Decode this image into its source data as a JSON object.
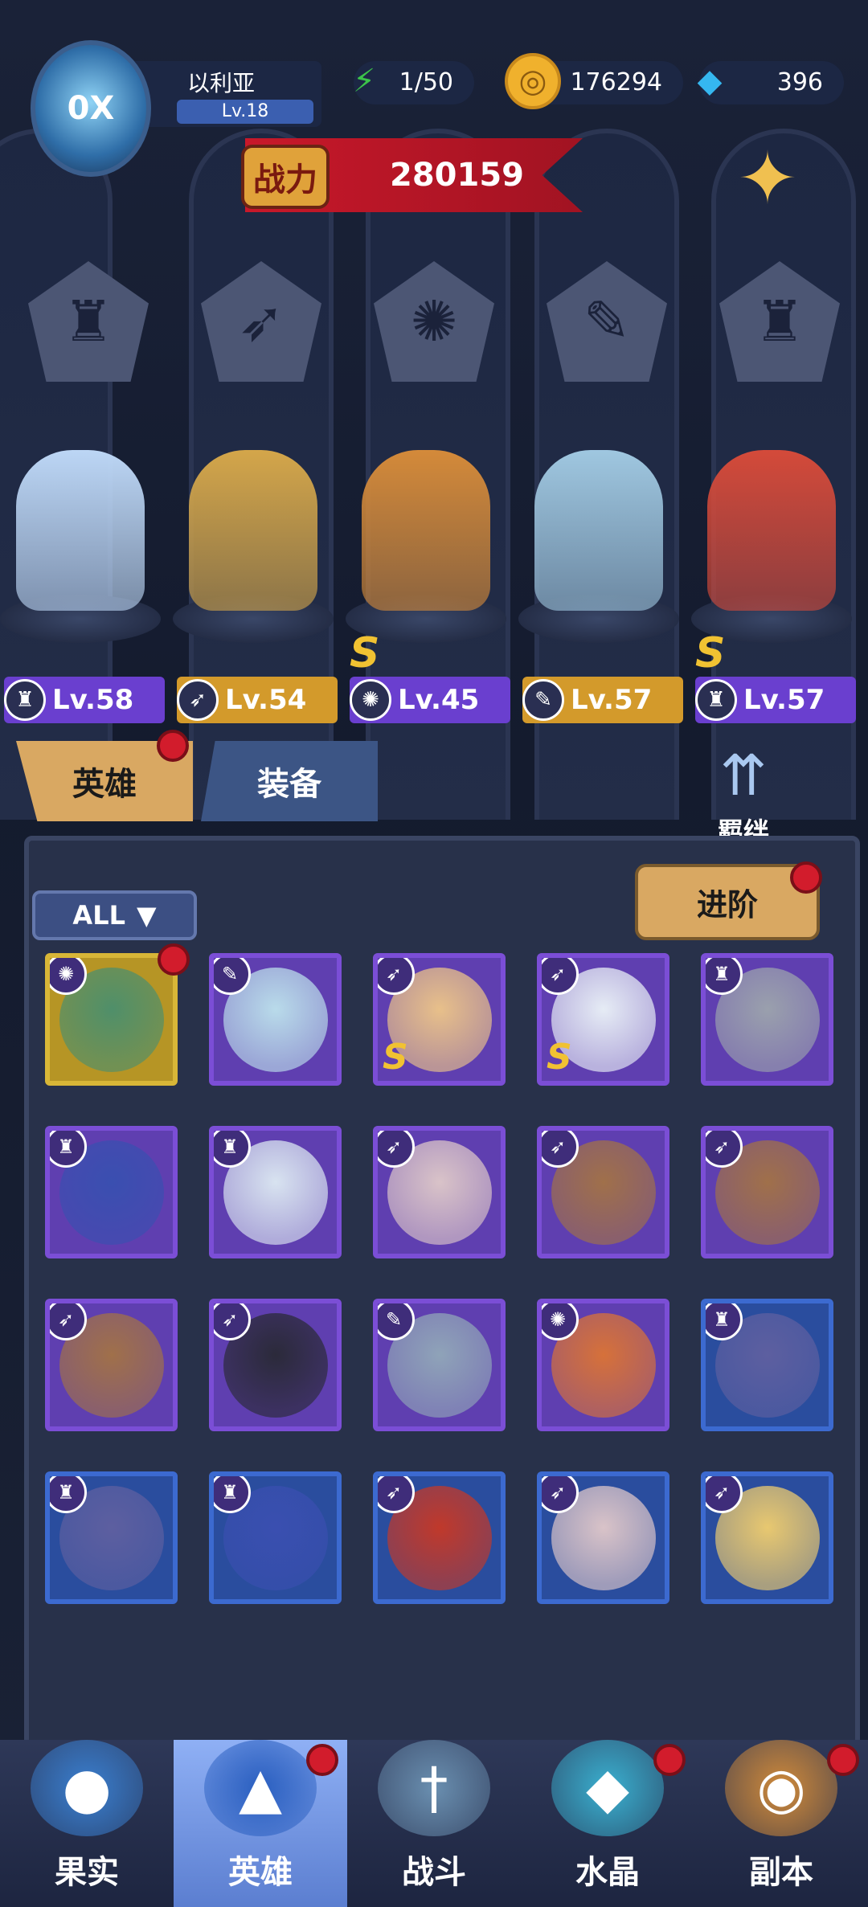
{
  "player": {
    "name": "以利亚",
    "level": "Lv.18",
    "avatar_text": "0X"
  },
  "resources": {
    "energy": {
      "value": "1/50",
      "icon": "lightning-icon",
      "color": "#3cc34a"
    },
    "gold": {
      "value": "176294",
      "icon": "coin-icon",
      "color": "#f0b12d"
    },
    "gems": {
      "value": "396",
      "icon": "diamond-icon",
      "color": "#35b7f0"
    }
  },
  "power": {
    "label": "战力",
    "value": "280159"
  },
  "class_emblems": [
    "mage-hat-icon",
    "wing-icon",
    "beast-claw-icon",
    "wrench-icon",
    "mage-hat-icon"
  ],
  "lineup": [
    {
      "level": "Lv.58",
      "class_icon": "mage-hat-icon",
      "bar_color": "#6a3fcf",
      "s_rank": false,
      "hero_color": "#bcd6f5"
    },
    {
      "level": "Lv.54",
      "class_icon": "wing-icon",
      "bar_color": "#d39a2b",
      "s_rank": false,
      "hero_color": "#d4a64a"
    },
    {
      "level": "Lv.45",
      "class_icon": "beast-claw-icon",
      "bar_color": "#6a3fcf",
      "s_rank": true,
      "s_label": "S",
      "hero_color": "#d48a3a"
    },
    {
      "level": "Lv.57",
      "class_icon": "wrench-icon",
      "bar_color": "#d39a2b",
      "s_rank": false,
      "hero_color": "#9fc7e0"
    },
    {
      "level": "Lv.57",
      "class_icon": "mage-hat-icon",
      "bar_color": "#6a3fcf",
      "s_rank": true,
      "s_label": "S",
      "hero_color": "#d44a3a"
    }
  ],
  "tabs": {
    "hero": "英雄",
    "equipment": "装备"
  },
  "bond": {
    "label": "羁绊"
  },
  "filter": {
    "label": "ALL"
  },
  "advance": {
    "label": "进阶"
  },
  "roster": [
    {
      "frame": "gold",
      "class_icon": "beast-claw-icon",
      "face": "#4f8f6a",
      "dot": true,
      "s": false
    },
    {
      "frame": "purple",
      "class_icon": "wrench-icon",
      "face": "#b9dbea",
      "dot": false,
      "s": false
    },
    {
      "frame": "purple",
      "class_icon": "wing-icon",
      "face": "#e8c08a",
      "dot": false,
      "s": true
    },
    {
      "frame": "purple",
      "class_icon": "wing-icon",
      "face": "#e6ecf5",
      "dot": false,
      "s": true
    },
    {
      "frame": "purple",
      "class_icon": "mage-hat-icon",
      "face": "#9aa0ad",
      "dot": false,
      "s": false
    },
    {
      "frame": "purple",
      "class_icon": "mage-hat-icon",
      "face": "#3a4fb0",
      "dot": false,
      "s": false
    },
    {
      "frame": "purple",
      "class_icon": "mage-hat-icon",
      "face": "#d8e3f0",
      "dot": false,
      "s": false
    },
    {
      "frame": "purple",
      "class_icon": "wing-icon",
      "face": "#d9c3c8",
      "dot": false,
      "s": false
    },
    {
      "frame": "purple",
      "class_icon": "wing-icon",
      "face": "#a0704a",
      "dot": false,
      "s": false
    },
    {
      "frame": "purple",
      "class_icon": "wing-icon",
      "face": "#a0704a",
      "dot": false,
      "s": false
    },
    {
      "frame": "purple",
      "class_icon": "wing-icon",
      "face": "#a0704a",
      "dot": false,
      "s": false
    },
    {
      "frame": "purple",
      "class_icon": "wing-icon",
      "face": "#2b2a3a",
      "dot": false,
      "s": false
    },
    {
      "frame": "purple",
      "class_icon": "wrench-icon",
      "face": "#8fa3b8",
      "dot": false,
      "s": false
    },
    {
      "frame": "purple",
      "class_icon": "beast-claw-icon",
      "face": "#d6713a",
      "dot": false,
      "s": false
    },
    {
      "frame": "blue",
      "class_icon": "mage-hat-icon",
      "face": "#5d5fa0",
      "dot": false,
      "s": false
    },
    {
      "frame": "blue",
      "class_icon": "mage-hat-icon",
      "face": "#5d5fa0",
      "dot": false,
      "s": false
    },
    {
      "frame": "blue",
      "class_icon": "mage-hat-icon",
      "face": "#3a4fb0",
      "dot": false,
      "s": false
    },
    {
      "frame": "blue",
      "class_icon": "wing-icon",
      "face": "#c0392b",
      "dot": false,
      "s": false
    },
    {
      "frame": "blue",
      "class_icon": "wing-icon",
      "face": "#d9c3c8",
      "dot": false,
      "s": false
    },
    {
      "frame": "blue",
      "class_icon": "wing-icon",
      "face": "#e8c870",
      "dot": false,
      "s": false
    }
  ],
  "nav": [
    {
      "label": "果实",
      "icon": "fruit-icon",
      "color": "#3a7fd0",
      "active": false,
      "dot": false
    },
    {
      "label": "英雄",
      "icon": "wizard-hat-icon",
      "color": "#2a5fc0",
      "active": true,
      "dot": true
    },
    {
      "label": "战斗",
      "icon": "sword-icon",
      "color": "#6a8fb0",
      "active": false,
      "dot": false
    },
    {
      "label": "水晶",
      "icon": "crystal-icon",
      "color": "#3ab0d0",
      "active": false,
      "dot": true
    },
    {
      "label": "副本",
      "icon": "portal-icon",
      "color": "#d08a3a",
      "active": false,
      "dot": true
    }
  ]
}
